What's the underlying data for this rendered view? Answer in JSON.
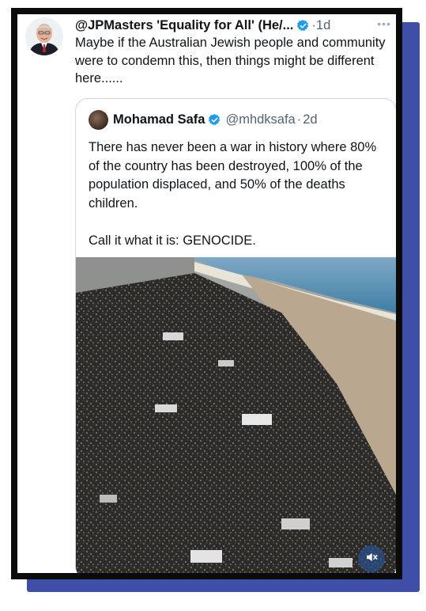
{
  "tweet": {
    "author": "@JPMasters 'Equality for All' (He/...",
    "separator": "·",
    "time": "1d",
    "more": "•••",
    "text": "Maybe if the Australian Jewish people and community were to condemn this, then things might be different here......"
  },
  "quote": {
    "name": "Mohamad Safa",
    "handle": "@mhdksafa",
    "separator": "·",
    "time": "2d",
    "text": "There has never been a war in history where 80% of the country has been destroyed, 100% of the population displaced, and 50% of the deaths children.\n\nCall it what it is: GENOCIDE."
  },
  "icons": {
    "verified": "verified-badge-icon",
    "more": "more-options-icon",
    "mute": "speaker-muted-icon"
  },
  "colors": {
    "verified_blue": "#1d9bf0",
    "frame": "#0b0b0b",
    "frame_shadow": "#3f4fa8"
  }
}
